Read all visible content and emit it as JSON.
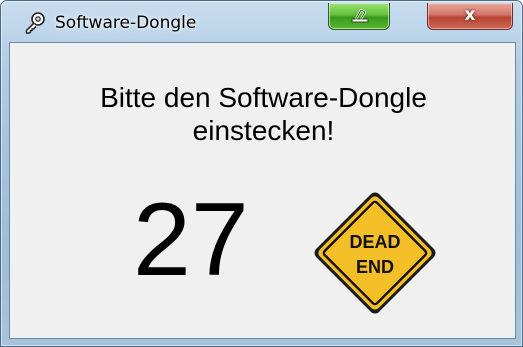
{
  "window": {
    "title": "Software-Dongle",
    "app_icon": "wrench-key-icon",
    "minimize_icon": "minimize-icon",
    "close_label": "x"
  },
  "message": {
    "line1": "Bitte den Software-Dongle",
    "line2": "einstecken!"
  },
  "countdown": "27",
  "sign": {
    "icon": "dead-end-sign-icon",
    "line1": "DEAD",
    "line2": "END",
    "color": "#f4bf26"
  }
}
